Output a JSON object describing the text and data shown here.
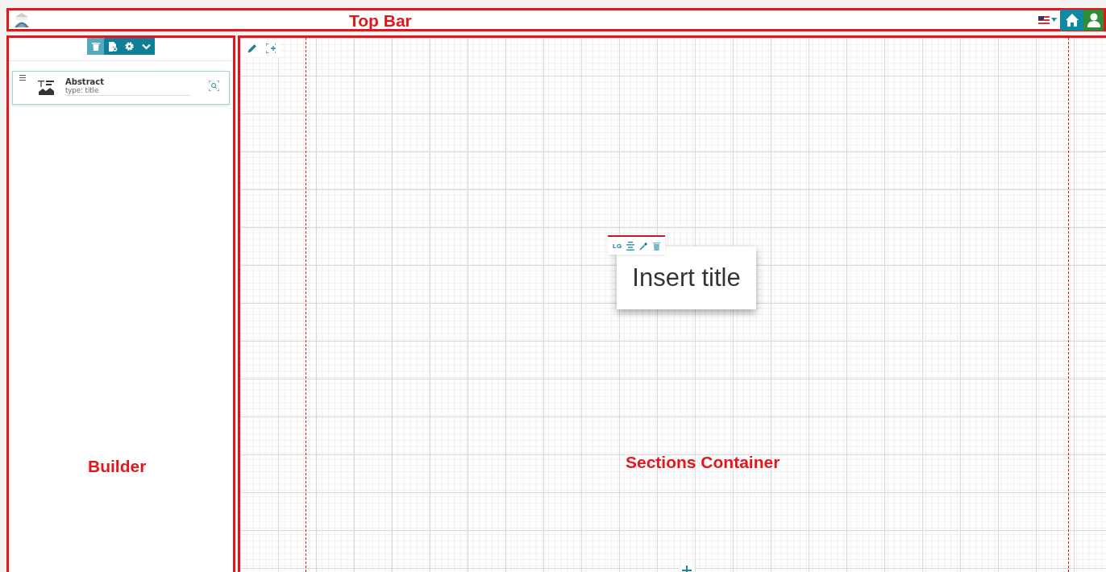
{
  "top_bar": {
    "annotation": "Top Bar"
  },
  "builder": {
    "annotation": "Builder",
    "items": [
      {
        "title": "Abstract",
        "type": "type: title"
      }
    ]
  },
  "sections_container": {
    "annotation": "Sections Container",
    "title_block": {
      "size": "LG",
      "text": "Insert title"
    }
  }
}
